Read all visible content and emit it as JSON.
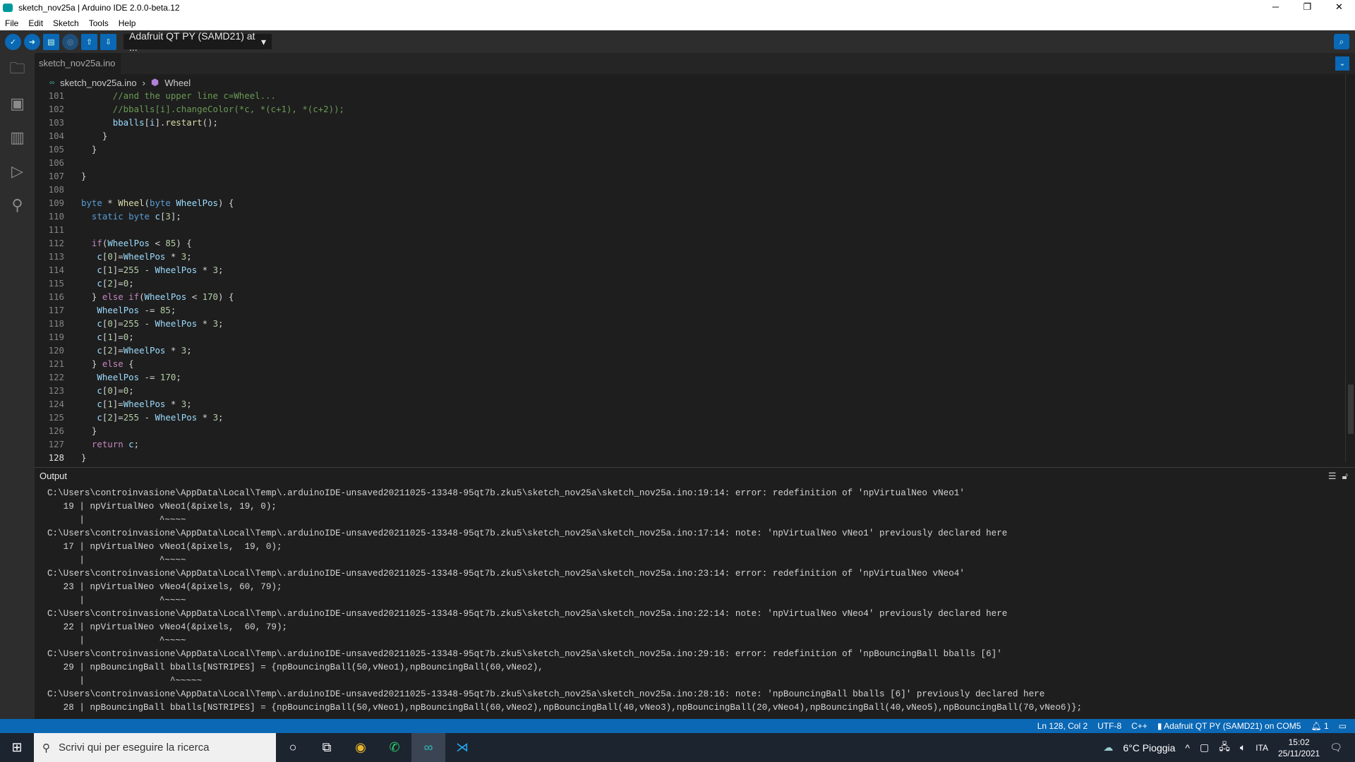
{
  "window": {
    "title": "sketch_nov25a | Arduino IDE 2.0.0-beta.12",
    "minimize": "─",
    "restore": "❐",
    "close": "✕"
  },
  "menu": [
    "File",
    "Edit",
    "Sketch",
    "Tools",
    "Help"
  ],
  "toolbar": {
    "board": "Adafruit QT PY (SAMD21) at ...",
    "icons": [
      "verify-icon",
      "upload-icon",
      "new-icon",
      "debug-icon",
      "open-icon",
      "save-icon"
    ]
  },
  "tab": {
    "label": "sketch_nov25a.ino"
  },
  "breadcrumb": {
    "file": "sketch_nov25a.ino",
    "symbol": "Wheel"
  },
  "editor": {
    "current_line": 128,
    "lines": [
      {
        "n": 101,
        "t": "      //and the upper line c=Wheel..."
      },
      {
        "n": 102,
        "t": "      //bballs[i].changeColor(*c, *(c+1), *(c+2));"
      },
      {
        "n": 103,
        "t": "      bballs[i].restart();"
      },
      {
        "n": 104,
        "t": "    }"
      },
      {
        "n": 105,
        "t": "  }"
      },
      {
        "n": 106,
        "t": ""
      },
      {
        "n": 107,
        "t": "}"
      },
      {
        "n": 108,
        "t": ""
      },
      {
        "n": 109,
        "t": "byte * Wheel(byte WheelPos) {"
      },
      {
        "n": 110,
        "t": "  static byte c[3];"
      },
      {
        "n": 111,
        "t": ""
      },
      {
        "n": 112,
        "t": "  if(WheelPos < 85) {"
      },
      {
        "n": 113,
        "t": "   c[0]=WheelPos * 3;"
      },
      {
        "n": 114,
        "t": "   c[1]=255 - WheelPos * 3;"
      },
      {
        "n": 115,
        "t": "   c[2]=0;"
      },
      {
        "n": 116,
        "t": "  } else if(WheelPos < 170) {"
      },
      {
        "n": 117,
        "t": "   WheelPos -= 85;"
      },
      {
        "n": 118,
        "t": "   c[0]=255 - WheelPos * 3;"
      },
      {
        "n": 119,
        "t": "   c[1]=0;"
      },
      {
        "n": 120,
        "t": "   c[2]=WheelPos * 3;"
      },
      {
        "n": 121,
        "t": "  } else {"
      },
      {
        "n": 122,
        "t": "   WheelPos -= 170;"
      },
      {
        "n": 123,
        "t": "   c[0]=0;"
      },
      {
        "n": 124,
        "t": "   c[1]=WheelPos * 3;"
      },
      {
        "n": 125,
        "t": "   c[2]=255 - WheelPos * 3;"
      },
      {
        "n": 126,
        "t": "  }"
      },
      {
        "n": 127,
        "t": "  return c;"
      },
      {
        "n": 128,
        "t": "}"
      }
    ]
  },
  "output": {
    "title": "Output",
    "lines": [
      "C:\\Users\\controinvasione\\AppData\\Local\\Temp\\.arduinoIDE-unsaved20211025-13348-95qt7b.zku5\\sketch_nov25a\\sketch_nov25a.ino:19:14: error: redefinition of 'npVirtualNeo vNeo1'",
      "   19 | npVirtualNeo vNeo1(&pixels, 19, 0);",
      "      |              ^~~~~",
      "C:\\Users\\controinvasione\\AppData\\Local\\Temp\\.arduinoIDE-unsaved20211025-13348-95qt7b.zku5\\sketch_nov25a\\sketch_nov25a.ino:17:14: note: 'npVirtualNeo vNeo1' previously declared here",
      "   17 | npVirtualNeo vNeo1(&pixels,  19, 0);",
      "      |              ^~~~~",
      "C:\\Users\\controinvasione\\AppData\\Local\\Temp\\.arduinoIDE-unsaved20211025-13348-95qt7b.zku5\\sketch_nov25a\\sketch_nov25a.ino:23:14: error: redefinition of 'npVirtualNeo vNeo4'",
      "   23 | npVirtualNeo vNeo4(&pixels, 60, 79);",
      "      |              ^~~~~",
      "C:\\Users\\controinvasione\\AppData\\Local\\Temp\\.arduinoIDE-unsaved20211025-13348-95qt7b.zku5\\sketch_nov25a\\sketch_nov25a.ino:22:14: note: 'npVirtualNeo vNeo4' previously declared here",
      "   22 | npVirtualNeo vNeo4(&pixels,  60, 79);",
      "      |              ^~~~~",
      "C:\\Users\\controinvasione\\AppData\\Local\\Temp\\.arduinoIDE-unsaved20211025-13348-95qt7b.zku5\\sketch_nov25a\\sketch_nov25a.ino:29:16: error: redefinition of 'npBouncingBall bballs [6]'",
      "   29 | npBouncingBall bballs[NSTRIPES] = {npBouncingBall(50,vNeo1),npBouncingBall(60,vNeo2),",
      "      |                ^~~~~~",
      "C:\\Users\\controinvasione\\AppData\\Local\\Temp\\.arduinoIDE-unsaved20211025-13348-95qt7b.zku5\\sketch_nov25a\\sketch_nov25a.ino:28:16: note: 'npBouncingBall bballs [6]' previously declared here",
      "   28 | npBouncingBall bballs[NSTRIPES] = {npBouncingBall(50,vNeo1),npBouncingBall(60,vNeo2),npBouncingBall(40,vNeo3),npBouncingBall(20,vNeo4),npBouncingBall(40,vNeo5),npBouncingBall(70,vNeo6)};"
    ]
  },
  "status": {
    "position": "Ln 128, Col 2",
    "encoding": "UTF-8",
    "language": "C++",
    "board": "Adafruit QT PY (SAMD21) on COM5",
    "notifications": "1"
  },
  "taskbar": {
    "search_placeholder": "Scrivi qui per eseguire la ricerca",
    "weather": "6°C  Pioggia",
    "language": "ITA",
    "time": "15:02",
    "date": "25/11/2021"
  },
  "colors": {
    "accent": "#0a68b5",
    "editor_bg": "#1e1e1e",
    "comment": "#6a9955",
    "keyword": "#569cd6"
  }
}
